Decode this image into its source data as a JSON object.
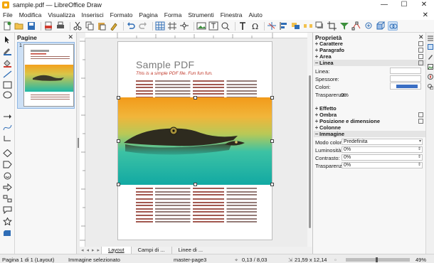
{
  "window": {
    "title": "sample.pdf — LibreOffice Draw",
    "minimize": "—",
    "maximize": "☐",
    "close": "✕"
  },
  "menu": [
    "File",
    "Modifica",
    "Visualizza",
    "Inserisci",
    "Formato",
    "Pagina",
    "Forma",
    "Strumenti",
    "Finestra",
    "Aiuto"
  ],
  "menu_close": "✕",
  "pages_panel": {
    "title": "Pagine",
    "close": "✕",
    "thumbnail_number": "1"
  },
  "document": {
    "title": "Sample PDF",
    "subtitle": "This is a simple PDF file. Fun fun fun."
  },
  "sidebar": {
    "title": "Proprietà",
    "close": "✕",
    "sections_top": [
      "Carattere",
      "Paragrafo",
      "Area",
      "Linea"
    ],
    "line": {
      "line_label": "Linea:",
      "thickness_label": "Spessore:",
      "color_label": "Colori:",
      "color_value": "#3b6fc4",
      "transparency_label": "Trasparenza:",
      "transparency_value": "0%"
    },
    "sections_mid": [
      "Effetto",
      "Ombra",
      "Posizione e dimensione",
      "Colonne",
      "Immagine"
    ],
    "image": {
      "color_mode_label": "Modo colore:",
      "color_mode_value": "Predefinita",
      "brightness_label": "Luminosità:",
      "brightness_value": "0%",
      "contrast_label": "Contrasto:",
      "contrast_value": "0%",
      "transparency_label": "Trasparenza:",
      "transparency_value": "0%"
    }
  },
  "bottom_tabs": [
    "Layout",
    "Campi di ...",
    "Linee di ..."
  ],
  "status": {
    "page": "Pagina 1 di 1 (Layout)",
    "selection": "Immagine selezionato",
    "master": "master-page3",
    "position": "0,13 / 8,03",
    "size": "21,59 x 12,14",
    "zoom": "49%"
  },
  "colors": {
    "accent": "#3b6fc4",
    "selection": "#cde0f5"
  }
}
